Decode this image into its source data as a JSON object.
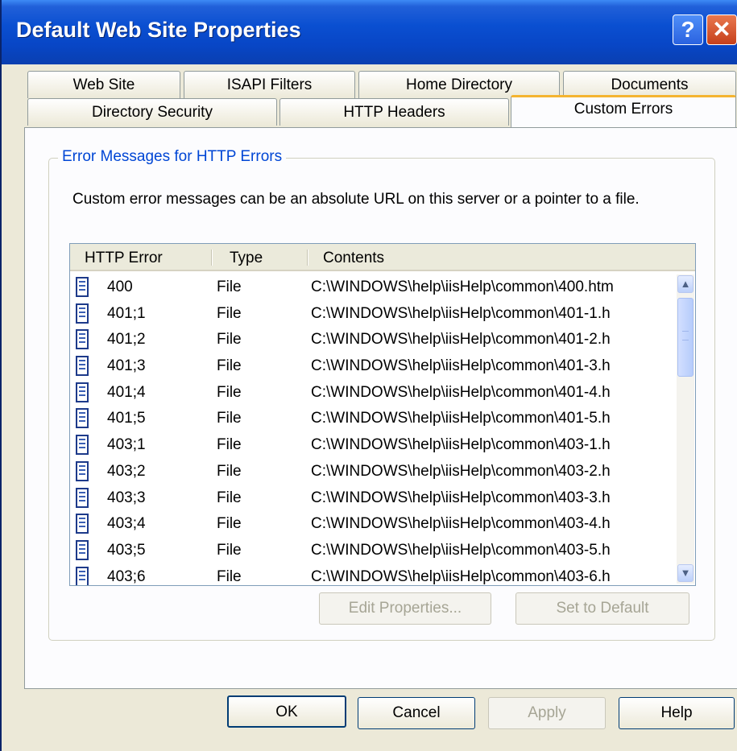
{
  "window": {
    "title": "Default Web Site Properties",
    "help_button_label": "?",
    "close_button_label": "✕"
  },
  "tabs": {
    "row1": [
      "Web Site",
      "ISAPI Filters",
      "Home Directory",
      "Documents"
    ],
    "row2": [
      "Directory Security",
      "HTTP Headers",
      "Custom Errors"
    ],
    "active": "Custom Errors"
  },
  "group": {
    "legend": "Error Messages for HTTP Errors",
    "description": "Custom error messages can be an absolute URL on this server or a pointer to a file."
  },
  "list": {
    "columns": [
      "HTTP Error",
      "Type",
      "Contents"
    ],
    "rows": [
      {
        "error": "400",
        "type": "File",
        "contents": "C:\\WINDOWS\\help\\iisHelp\\common\\400.htm"
      },
      {
        "error": "401;1",
        "type": "File",
        "contents": "C:\\WINDOWS\\help\\iisHelp\\common\\401-1.h"
      },
      {
        "error": "401;2",
        "type": "File",
        "contents": "C:\\WINDOWS\\help\\iisHelp\\common\\401-2.h"
      },
      {
        "error": "401;3",
        "type": "File",
        "contents": "C:\\WINDOWS\\help\\iisHelp\\common\\401-3.h"
      },
      {
        "error": "401;4",
        "type": "File",
        "contents": "C:\\WINDOWS\\help\\iisHelp\\common\\401-4.h"
      },
      {
        "error": "401;5",
        "type": "File",
        "contents": "C:\\WINDOWS\\help\\iisHelp\\common\\401-5.h"
      },
      {
        "error": "403;1",
        "type": "File",
        "contents": "C:\\WINDOWS\\help\\iisHelp\\common\\403-1.h"
      },
      {
        "error": "403;2",
        "type": "File",
        "contents": "C:\\WINDOWS\\help\\iisHelp\\common\\403-2.h"
      },
      {
        "error": "403;3",
        "type": "File",
        "contents": "C:\\WINDOWS\\help\\iisHelp\\common\\403-3.h"
      },
      {
        "error": "403;4",
        "type": "File",
        "contents": "C:\\WINDOWS\\help\\iisHelp\\common\\403-4.h"
      },
      {
        "error": "403;5",
        "type": "File",
        "contents": "C:\\WINDOWS\\help\\iisHelp\\common\\403-5.h"
      },
      {
        "error": "403;6",
        "type": "File",
        "contents": "C:\\WINDOWS\\help\\iisHelp\\common\\403-6.h"
      }
    ],
    "row_icon": "file-document-icon",
    "scroll_up": "▲",
    "scroll_down": "▼"
  },
  "group_buttons": {
    "edit": "Edit Properties...",
    "default": "Set to Default"
  },
  "dialog_buttons": {
    "ok": "OK",
    "cancel": "Cancel",
    "apply": "Apply",
    "help": "Help"
  }
}
